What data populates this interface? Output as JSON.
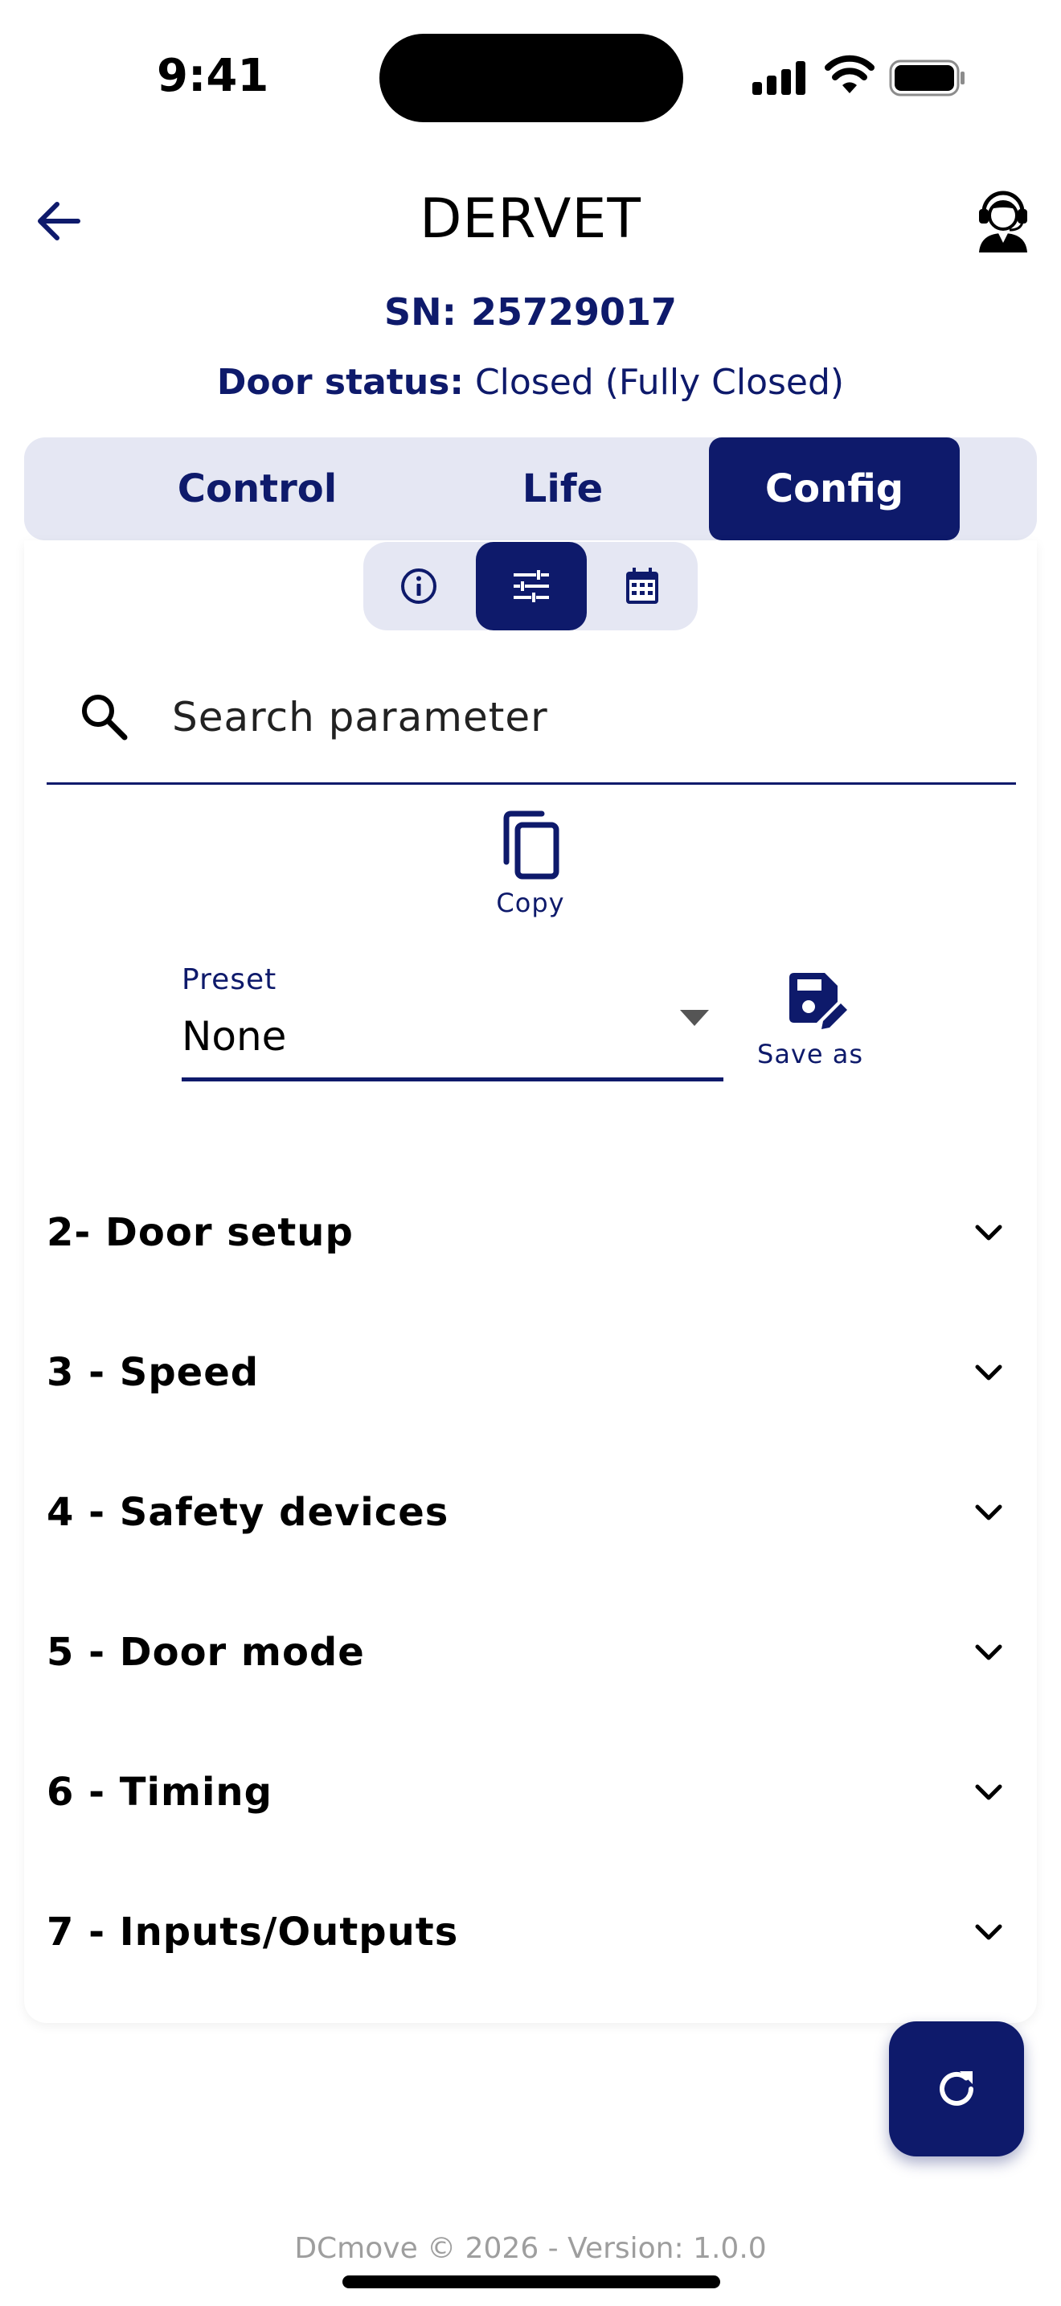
{
  "status_bar": {
    "time": "9:41",
    "icons": [
      "signal-icon",
      "wifi-icon",
      "battery-icon"
    ]
  },
  "header": {
    "title": "DERVET",
    "back_icon": "arrow-left-icon",
    "support_icon": "support-agent-icon"
  },
  "device": {
    "sn_label": "SN:",
    "sn_value": "25729017",
    "door_status_label": "Door status:",
    "door_status_value": "Closed (Fully Closed)"
  },
  "tabs": [
    {
      "label": "Control",
      "active": false
    },
    {
      "label": "Life",
      "active": false
    },
    {
      "label": "Config",
      "active": true
    }
  ],
  "sub_tabs": [
    {
      "icon": "info-icon",
      "active": false
    },
    {
      "icon": "sliders-icon",
      "active": true
    },
    {
      "icon": "calendar-icon",
      "active": false
    }
  ],
  "search": {
    "placeholder": "Search parameter",
    "value": ""
  },
  "copy": {
    "label": "Copy",
    "icon": "copy-icon"
  },
  "preset": {
    "label": "Preset",
    "value": "None",
    "save_as_label": "Save as",
    "save_icon": "save-edit-icon"
  },
  "sections": [
    {
      "label": "2- Door setup"
    },
    {
      "label": "3 - Speed"
    },
    {
      "label": "4 - Safety devices"
    },
    {
      "label": "5 - Door mode"
    },
    {
      "label": "6 - Timing"
    },
    {
      "label": "7 - Inputs/Outputs"
    }
  ],
  "fab": {
    "icon": "refresh-icon"
  },
  "footer": {
    "text": "DCmove © 2026 - Version: 1.0.0"
  },
  "colors": {
    "primary": "#0e1a6b",
    "tab_background": "#e5e7f3",
    "footer_text": "#9e9e9e"
  }
}
